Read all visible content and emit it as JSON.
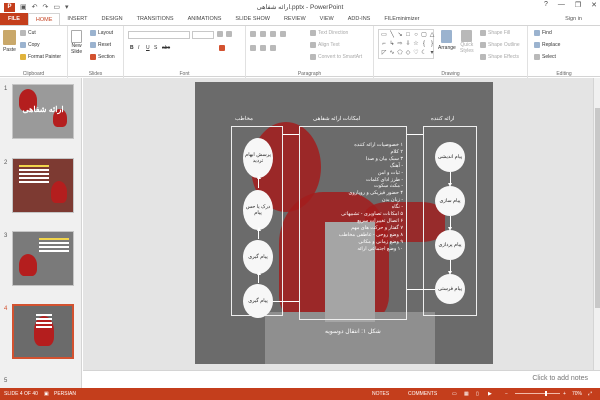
{
  "window": {
    "title": "ارائه شفاهی.pptx - PowerPoint",
    "app_icon": "P",
    "controls": [
      "?",
      "—",
      "❐",
      "✕"
    ]
  },
  "tabs": [
    "FILE",
    "HOME",
    "INSERT",
    "DESIGN",
    "TRANSITIONS",
    "ANIMATIONS",
    "SLIDE SHOW",
    "REVIEW",
    "VIEW",
    "ADD-INS",
    "FILEminimizer"
  ],
  "active_tab": "HOME",
  "signin": "Sign in",
  "ribbon": {
    "clipboard": {
      "paste": "Paste",
      "cut": "Cut",
      "copy": "Copy",
      "format_painter": "Format Painter",
      "label": "Clipboard"
    },
    "slides": {
      "new_slide": "New",
      "new_slide2": "Slide",
      "layout": "Layout",
      "reset": "Reset",
      "section": "Section",
      "label": "Slides"
    },
    "font": {
      "label": "Font",
      "bold": "B",
      "italic": "I",
      "underline": "U",
      "strike": "S",
      "abc": "abc"
    },
    "paragraph": {
      "text_direction": "Text Direction",
      "align_text": "Align Text",
      "convert_smartart": "Convert to SmartArt",
      "label": "Paragraph"
    },
    "drawing": {
      "arrange": "Arrange",
      "quick_styles": "Quick",
      "quick_styles2": "Styles",
      "shape_fill": "Shape Fill",
      "shape_outline": "Shape Outline",
      "shape_effects": "Shape Effects",
      "label": "Drawing"
    },
    "editing": {
      "find": "Find",
      "replace": "Replace",
      "select": "Select",
      "label": "Editing"
    }
  },
  "thumbnails": [
    {
      "num": "1",
      "title": "ارائه شفاهی"
    },
    {
      "num": "2"
    },
    {
      "num": "3"
    },
    {
      "num": "4"
    },
    {
      "num": "5"
    }
  ],
  "slide": {
    "col_left_title": "مخاطب",
    "col_mid_title": "امکانات ارائه شفاهی",
    "col_right_title": "ارائه کننده",
    "left_ovals": [
      "پرسش ابهام تردید",
      "درک یا حس پیام",
      "پیام گیری",
      "پیام گیری"
    ],
    "right_ovals": [
      "پیام اندیشی",
      "پیام سازی",
      "پیام پردازی",
      "پیام فرستی"
    ],
    "list": [
      "۱    خصوصیات ارائه کننده",
      "۲    کلام",
      "۳    سبک بیان و صدا",
      "    - آهنگ",
      "    - ثبات و امن",
      "    - طرز ادای کلمات",
      "    - مکث سکوت",
      "۴    حضور فیزیکی و رویاروی",
      "    - زبان بدن",
      "    - نگاه",
      "۵    امکانات تصاویری - تشبیهاتی",
      "۶    اتصال تغییرات سریع",
      "۷    گفتار و حرکت های مهم",
      "۸    وضع روحی - عاطفی مخاطب",
      "۹    وضع زمانی و مکانی",
      "۱۰   وضع اجتماعی ارائه"
    ],
    "caption": "شکل ۱: انتقال دوسویه"
  },
  "notes_placeholder": "Click to add notes",
  "status": {
    "slide_info": "SLIDE 4 OF 40",
    "language": "PERSIAN",
    "notes": "NOTES",
    "comments": "COMMENTS",
    "zoom": "70%"
  }
}
